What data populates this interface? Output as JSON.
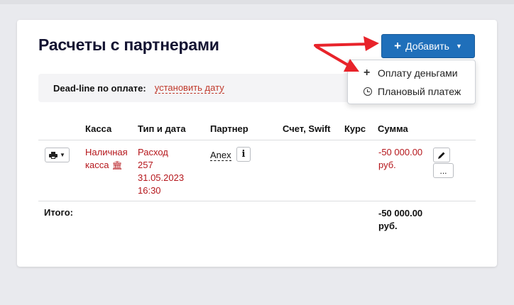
{
  "page": {
    "title": "Расчеты с партнерами",
    "add_button": {
      "label": "Добавить",
      "icon": "plus-icon"
    },
    "add_menu": [
      {
        "label": "Оплату деньгами",
        "icon": "plus-icon"
      },
      {
        "label": "Плановый платеж",
        "icon": "clock-icon"
      }
    ],
    "deadline": {
      "label": "Dead-line по оплате:",
      "link": "установить дату"
    }
  },
  "table": {
    "headers": [
      "Касса",
      "Тип и дата",
      "Партнер",
      "Счет, Swift",
      "Курс",
      "Сумма"
    ],
    "rows": [
      {
        "kassa_line1": "Наличная",
        "kassa_line2": "касса",
        "type_line1": "Расход",
        "type_line2": "257",
        "date": "31.05.2023",
        "time": "16:30",
        "partner": "Anex",
        "account": "",
        "rate": "",
        "sum_line1": "-50 000.00",
        "sum_line2": "руб."
      }
    ],
    "total": {
      "label": "Итого:",
      "sum_line1": "-50 000.00",
      "sum_line2": "руб."
    },
    "more_label": "..."
  },
  "colors": {
    "accent": "#1f6fba",
    "negative": "#b5161b",
    "annotation_arrow": "#e8232a"
  }
}
